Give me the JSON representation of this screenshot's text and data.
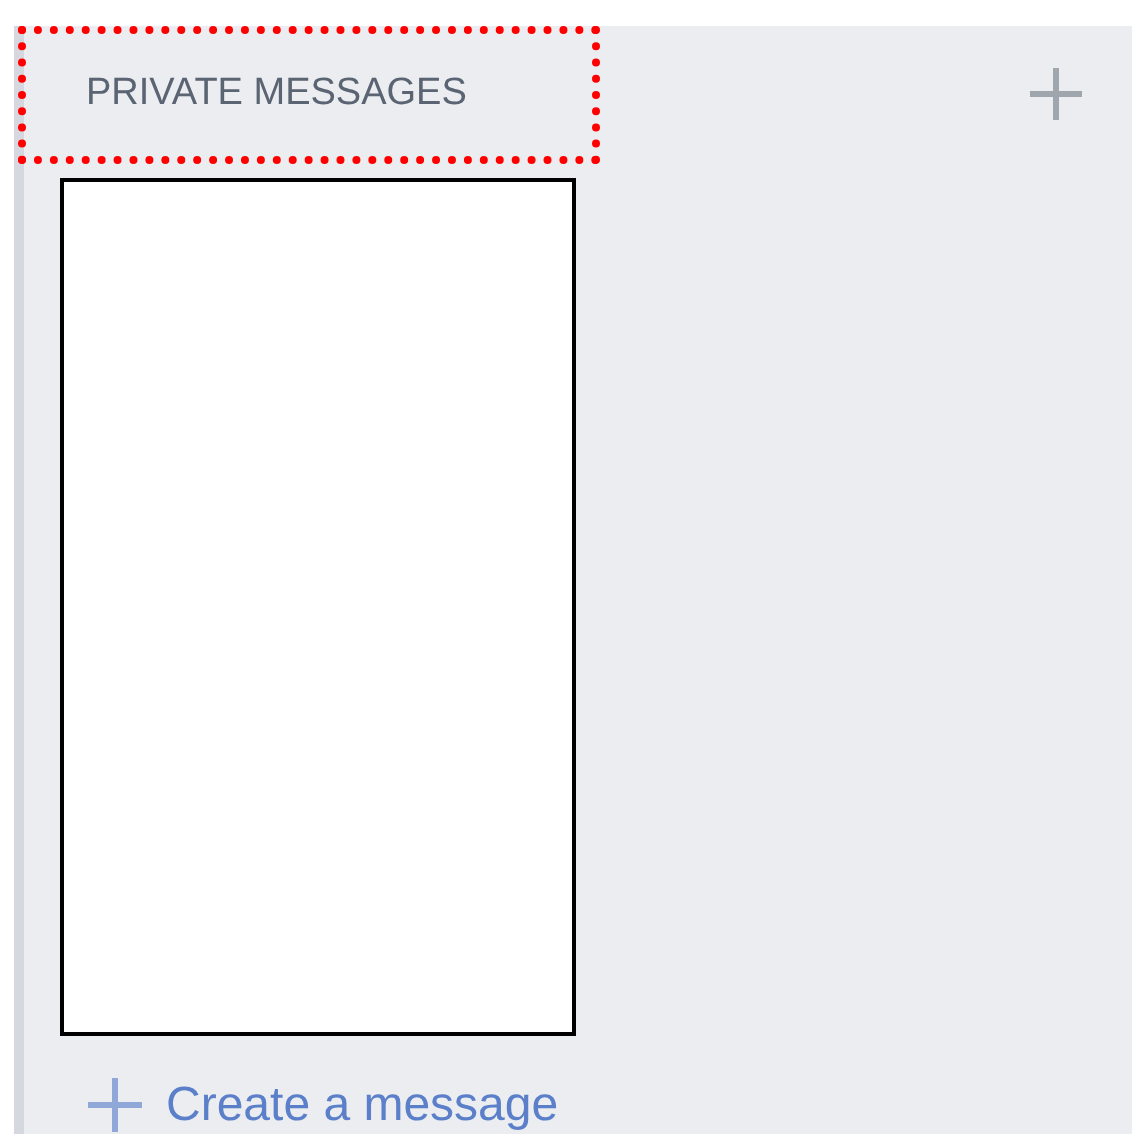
{
  "section": {
    "title": "PRIVATE MESSAGES",
    "highlighted": true
  },
  "create_link": {
    "label": "Create a message"
  }
}
